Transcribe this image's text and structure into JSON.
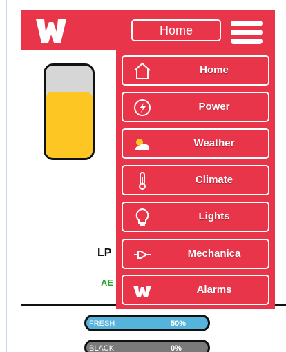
{
  "header": {
    "logo_letter": "W",
    "current_page": "Home",
    "menu_icon": "hamburger-icon"
  },
  "colors": {
    "brand_red": "#e8354a",
    "tank_fill": "#fdc623",
    "tank_empty": "#d6d6d6",
    "fresh_bar": "#55b4dc",
    "black_bar": "#7a7a7a",
    "status_green": "#2ba62b"
  },
  "tank": {
    "level_fraction": 0.72
  },
  "labels": {
    "lp": "LP",
    "ab": "AE"
  },
  "bars": [
    {
      "name": "FRESH",
      "percent": "50%"
    },
    {
      "name": "BLACK",
      "percent": "0%"
    }
  ],
  "menu": {
    "items": [
      {
        "label": "Home",
        "icon": "house-icon"
      },
      {
        "label": "Power",
        "icon": "power-bolt-icon"
      },
      {
        "label": "Weather",
        "icon": "cloud-sun-icon"
      },
      {
        "label": "Climate",
        "icon": "thermometer-icon"
      },
      {
        "label": "Lights",
        "icon": "lightbulb-icon"
      },
      {
        "label": "Mechanica",
        "icon": "plug-icon"
      },
      {
        "label": "Alarms",
        "icon": "w-logo-icon"
      }
    ]
  }
}
